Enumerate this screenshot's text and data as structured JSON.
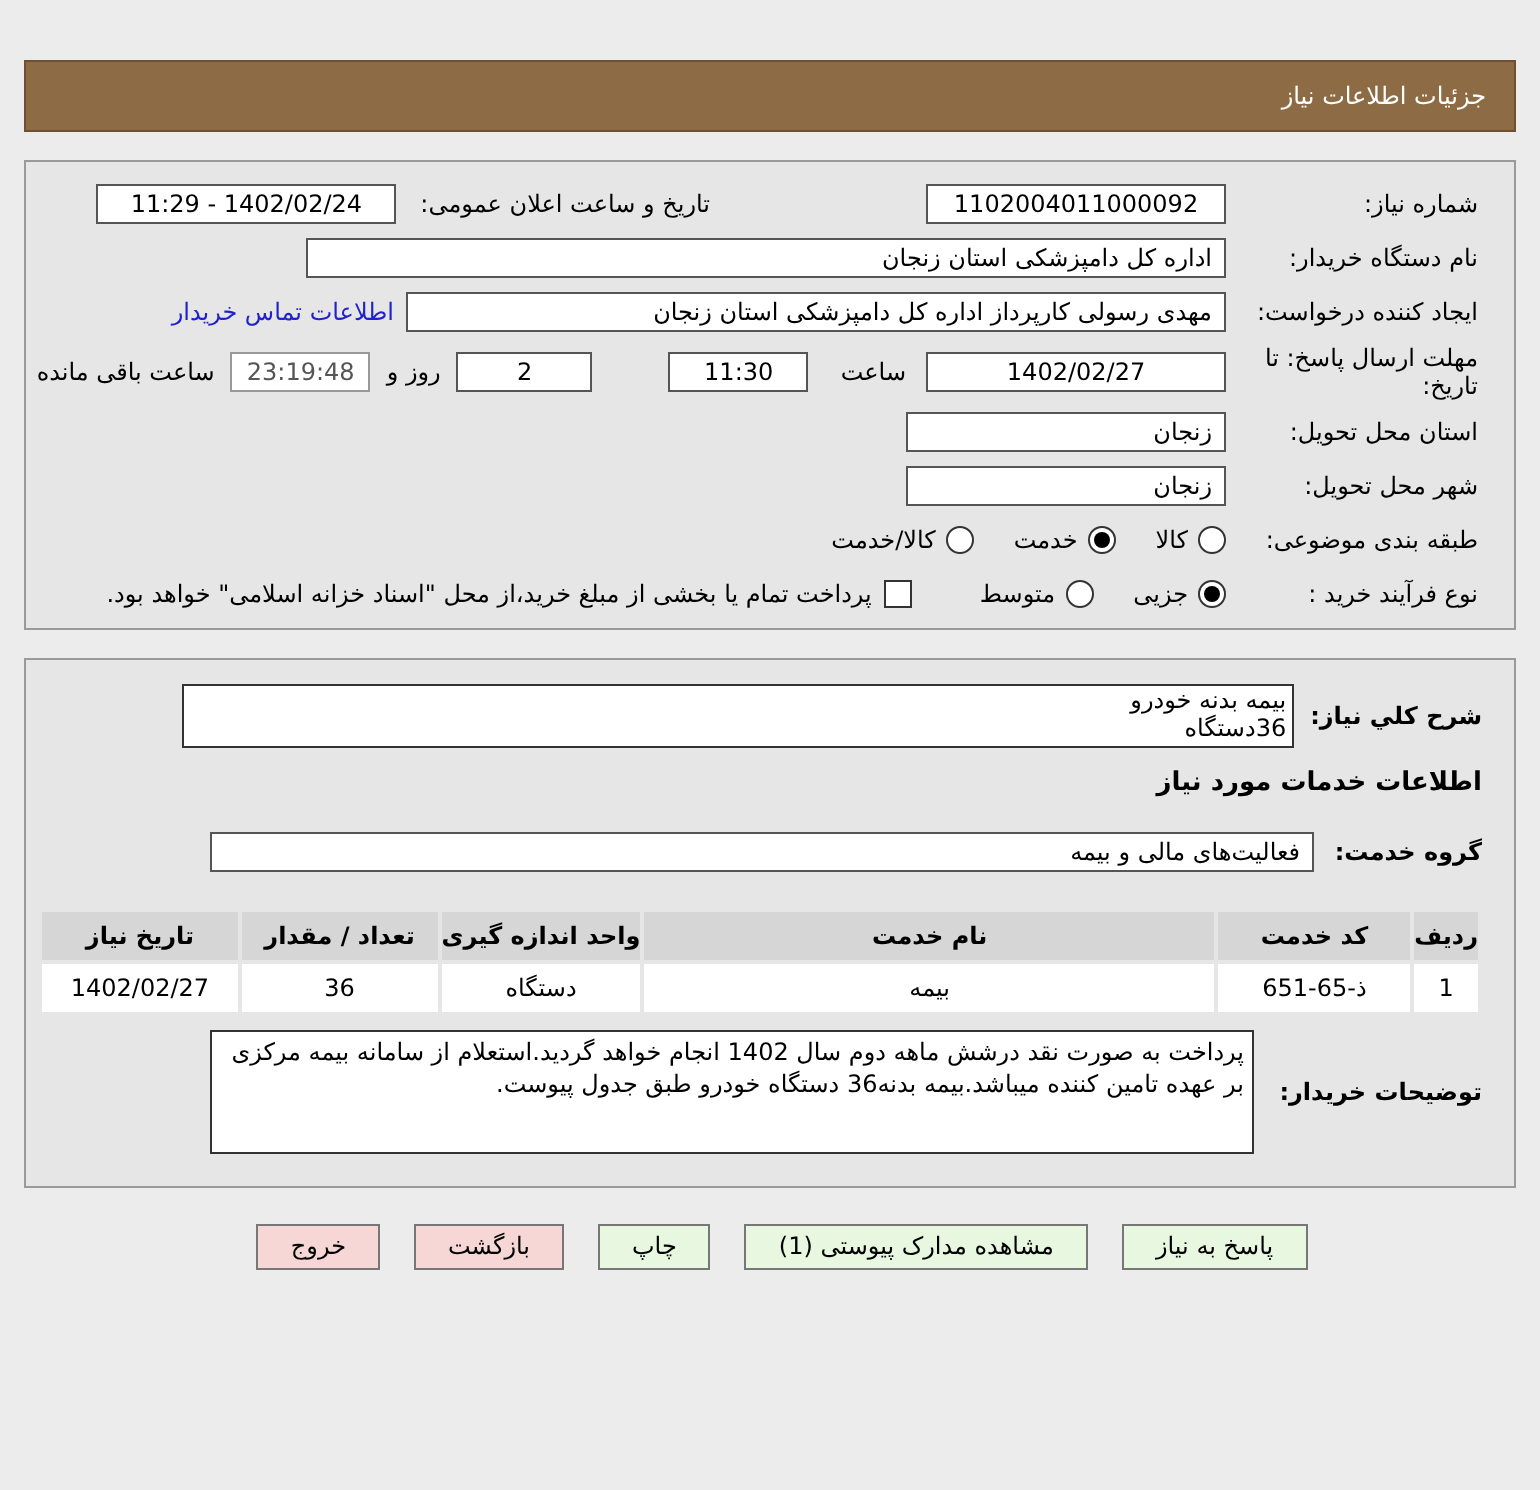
{
  "header": {
    "title": "جزئیات اطلاعات نیاز"
  },
  "need_number": {
    "label": "شماره نیاز:",
    "value": "1102004011000092"
  },
  "announce_date": {
    "label": "تاریخ و ساعت اعلان عمومی:",
    "value": "1402/02/24 - 11:29"
  },
  "buyer_org": {
    "label": "نام دستگاه خریدار:",
    "value": "اداره کل دامپزشکی استان زنجان"
  },
  "requester": {
    "label": "ایجاد کننده درخواست:",
    "value": "مهدی رسولی کارپرداز اداره کل دامپزشکی استان زنجان",
    "contact_link": "اطلاعات تماس خریدار"
  },
  "deadline": {
    "label": "مهلت ارسال پاسخ: تا تاریخ:",
    "date": "1402/02/27",
    "time_label": "ساعت",
    "time": "11:30",
    "days": "2",
    "days_label": "روز و",
    "remaining": "23:19:48",
    "remaining_label": "ساعت باقی مانده"
  },
  "province": {
    "label": "استان محل تحویل:",
    "value": "زنجان"
  },
  "city": {
    "label": "شهر محل تحویل:",
    "value": "زنجان"
  },
  "category": {
    "label": "طبقه بندی موضوعی:",
    "options": [
      {
        "label": "کالا",
        "selected": false
      },
      {
        "label": "خدمت",
        "selected": true
      },
      {
        "label": "کالا/خدمت",
        "selected": false
      }
    ]
  },
  "purchase_process": {
    "label": "نوع فرآیند خرید :",
    "options": [
      {
        "label": "جزیی",
        "selected": true
      },
      {
        "label": "متوسط",
        "selected": false
      }
    ],
    "treasury": {
      "checked": false,
      "text": "پرداخت تمام یا بخشی از مبلغ خرید،از محل \"اسناد خزانه اسلامی\" خواهد بود."
    }
  },
  "summary": {
    "label": "شرح كلي نياز:",
    "lines": [
      "بیمه بدنه خودرو",
      "36دستگاه"
    ]
  },
  "services_heading": "اطلاعات خدمات مورد نیاز",
  "service_group": {
    "label": "گروه خدمت:",
    "value": "فعالیت‌های مالی و بیمه"
  },
  "table": {
    "columns": [
      "ردیف",
      "کد خدمت",
      "نام خدمت",
      "واحد اندازه گیری",
      "تعداد / مقدار",
      "تاریخ نیاز"
    ],
    "rows": [
      [
        "1",
        "ذ-65-651",
        "بیمه",
        "دستگاه",
        "36",
        "1402/02/27"
      ]
    ]
  },
  "buyer_notes": {
    "label": "توضیحات خریدار:",
    "text": "پرداخت به صورت نقد درشش ماهه دوم سال 1402 انجام خواهد گردید.استعلام از سامانه بیمه مرکزی بر عهده تامین کننده میباشد.بیمه بدنه36 دستگاه خودرو طبق جدول پیوست."
  },
  "buttons": [
    {
      "label": "پاسخ به نیاز",
      "kind": "normal"
    },
    {
      "label": "مشاهده مدارک پیوستی (1)",
      "kind": "normal"
    },
    {
      "label": "چاپ",
      "kind": "normal"
    },
    {
      "label": "بازگشت",
      "kind": "danger"
    },
    {
      "label": "خروج",
      "kind": "danger"
    }
  ]
}
